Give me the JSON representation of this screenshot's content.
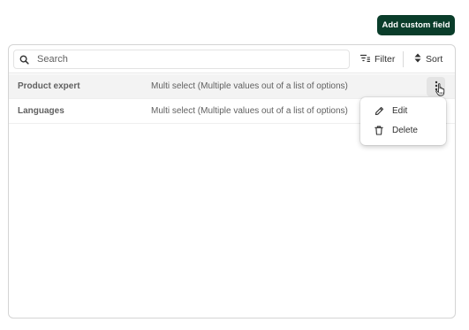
{
  "header": {
    "add_button_label": "Add custom field"
  },
  "toolbar": {
    "search_placeholder": "Search",
    "search_value": "",
    "filter_label": "Filter",
    "sort_label": "Sort"
  },
  "fields": [
    {
      "name": "Product expert",
      "type": "Multi select (Multiple values out of a list of options)"
    },
    {
      "name": "Languages",
      "type": "Multi select (Multiple values out of a list of options)"
    }
  ],
  "row_menu": {
    "items": [
      {
        "label": "Edit",
        "icon": "pencil-icon"
      },
      {
        "label": "Delete",
        "icon": "trash-icon"
      }
    ]
  },
  "colors": {
    "primary_button": "#0a3d2a",
    "border": "#d4d4d4",
    "row_hover": "#f3f3f3",
    "text_secondary": "#616161"
  }
}
